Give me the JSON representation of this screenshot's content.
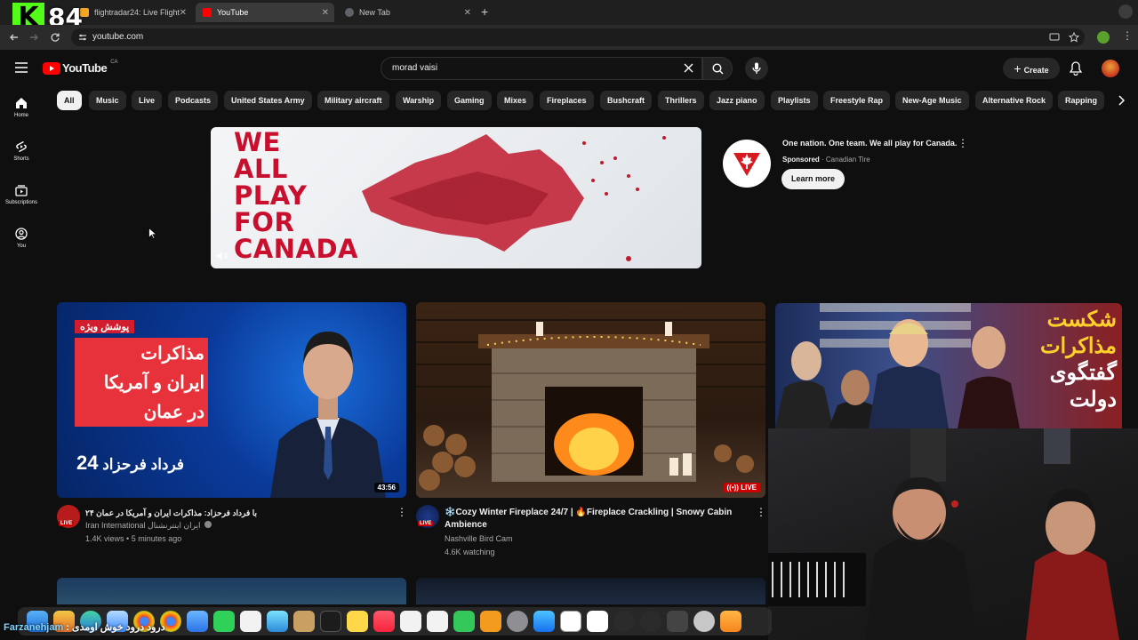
{
  "stream": {
    "kick_logo": "K",
    "viewer_count": "84",
    "caption_name": "Farzanehjam",
    "caption_text": ": درود درود خوش اومدی"
  },
  "browser": {
    "tabs": [
      {
        "label": "flightradar24: Live Flight Tra..."
      },
      {
        "label": "YouTube"
      },
      {
        "label": "New Tab"
      }
    ],
    "url": "youtube.com"
  },
  "youtube": {
    "logo_text": "YouTube",
    "region": "CA",
    "search_query": "morad vaisi",
    "create_label": "Create"
  },
  "sidebar": [
    {
      "label": "Home",
      "icon": "home-icon"
    },
    {
      "label": "Shorts",
      "icon": "shorts-icon"
    },
    {
      "label": "Subscriptions",
      "icon": "subscriptions-icon"
    },
    {
      "label": "You",
      "icon": "you-icon"
    }
  ],
  "chips": [
    "All",
    "Music",
    "Live",
    "Podcasts",
    "United States Army",
    "Military aircraft",
    "Warship",
    "Gaming",
    "Mixes",
    "Fireplaces",
    "Bushcraft",
    "Thrillers",
    "Jazz piano",
    "Playlists",
    "Freestyle Rap",
    "New-Age Music",
    "Alternative Rock",
    "Rapping"
  ],
  "ad": {
    "banner_text": [
      "WE",
      "ALL",
      "PLAY",
      "FOR",
      "CANADA"
    ],
    "title": "One nation. One team. We all play for Canada.",
    "sponsored": "Sponsored",
    "advertiser": "Canadian Tire",
    "cta": "Learn more"
  },
  "videos": [
    {
      "title": "۲۴ با فرداد فرحزاد: مذاکرات ایران و آمریکا در عمان",
      "channel": "Iran International ایران اینترنشنال",
      "views": "1.4K views",
      "age": "5 minutes ago",
      "duration": "43:56",
      "thumb_badge": "پوشش ویژه",
      "thumb_headline": [
        "مذاکرات",
        "ایران و آمریکا",
        "در عمان"
      ],
      "thumb_footer": "فرداد فرحزاد",
      "thumb_number": "24",
      "avatar_live": "LIVE"
    },
    {
      "title": "❄️Cozy Winter Fireplace 24/7 | 🔥Fireplace Crackling | Snowy Cabin Ambience",
      "channel": "Nashville Bird Cam",
      "views": "4.6K watching",
      "live_badge": "LIVE",
      "avatar_live": "LIVE"
    },
    {
      "thumb_text": [
        "شکست",
        "مذاکرات",
        "گفتگوی",
        "دولت"
      ]
    }
  ]
}
